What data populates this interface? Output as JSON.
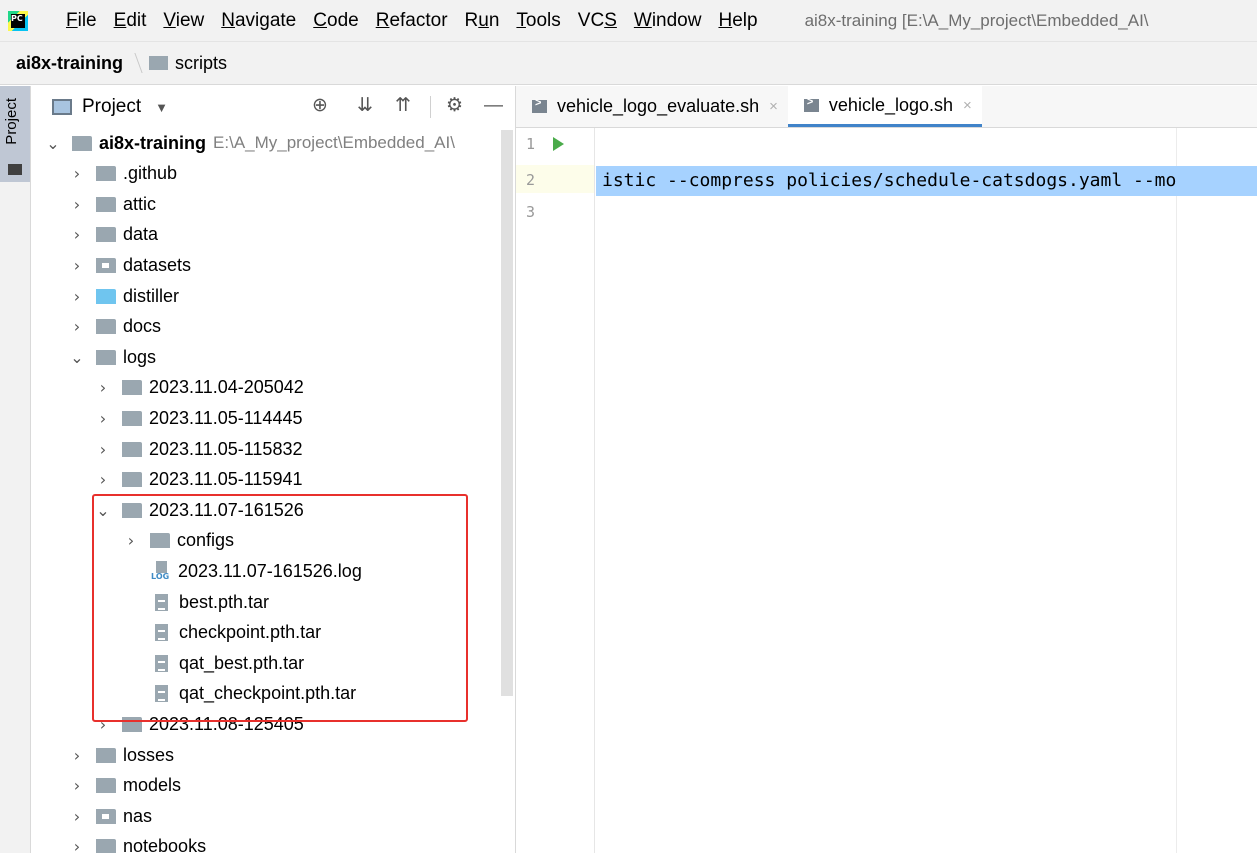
{
  "menubar": {
    "logo_text": "PC",
    "items": [
      {
        "u": "F",
        "rest": "ile"
      },
      {
        "u": "E",
        "rest": "dit"
      },
      {
        "u": "V",
        "rest": "iew"
      },
      {
        "u": "N",
        "rest": "avigate"
      },
      {
        "u": "C",
        "rest": "ode"
      },
      {
        "u": "R",
        "rest": "efactor"
      },
      {
        "pre": "R",
        "u": "u",
        "rest": "n"
      },
      {
        "u": "T",
        "rest": "ools"
      },
      {
        "pre": "VC",
        "u": "S",
        "rest": ""
      },
      {
        "u": "W",
        "rest": "indow"
      },
      {
        "u": "H",
        "rest": "elp"
      }
    ],
    "window_title": "ai8x-training [E:\\A_My_project\\Embedded_AI\\"
  },
  "breadcrumb": {
    "root": "ai8x-training",
    "folder": "scripts"
  },
  "left_stripe": {
    "label": "Project"
  },
  "project_panel": {
    "title": "Project",
    "caret": "▼",
    "buttons": {
      "locate": "⊕",
      "expand": "⇊",
      "collapse": "⇈",
      "settings": "⚙",
      "hide": "—"
    }
  },
  "tree": [
    {
      "label": "ai8x-training",
      "path": "E:\\A_My_project\\Embedded_AI\\",
      "bold": true,
      "chev": "⌄",
      "icon": "folder",
      "depth": 0
    },
    {
      "label": ".github",
      "chev": "›",
      "icon": "folder",
      "depth": 1
    },
    {
      "label": "attic",
      "chev": "›",
      "icon": "folder",
      "depth": 1
    },
    {
      "label": "data",
      "chev": "›",
      "icon": "folder",
      "depth": 1
    },
    {
      "label": "datasets",
      "chev": "›",
      "icon": "package",
      "depth": 1
    },
    {
      "label": "distiller",
      "chev": "›",
      "icon": "folder-blue",
      "depth": 1
    },
    {
      "label": "docs",
      "chev": "›",
      "icon": "folder",
      "depth": 1
    },
    {
      "label": "logs",
      "chev": "⌄",
      "icon": "folder",
      "depth": 1
    },
    {
      "label": "2023.11.04-205042",
      "chev": "›",
      "icon": "folder",
      "depth": 2
    },
    {
      "label": "2023.11.05-114445",
      "chev": "›",
      "icon": "folder",
      "depth": 2
    },
    {
      "label": "2023.11.05-115832",
      "chev": "›",
      "icon": "folder",
      "depth": 2
    },
    {
      "label": "2023.11.05-115941",
      "chev": "›",
      "icon": "folder",
      "depth": 2
    },
    {
      "label": "2023.11.07-161526",
      "chev": "⌄",
      "icon": "folder",
      "depth": 2
    },
    {
      "label": "configs",
      "chev": "›",
      "icon": "folder",
      "depth": 3
    },
    {
      "label": "2023.11.07-161526.log",
      "chev": "",
      "icon": "log",
      "depth": 3
    },
    {
      "label": "best.pth.tar",
      "chev": "",
      "icon": "file",
      "depth": 3
    },
    {
      "label": "checkpoint.pth.tar",
      "chev": "",
      "icon": "file",
      "depth": 3
    },
    {
      "label": "qat_best.pth.tar",
      "chev": "",
      "icon": "file",
      "depth": 3
    },
    {
      "label": "qat_checkpoint.pth.tar",
      "chev": "",
      "icon": "file",
      "depth": 3
    },
    {
      "label": "2023.11.08-125405",
      "chev": "›",
      "icon": "folder",
      "depth": 2
    },
    {
      "label": "losses",
      "chev": "›",
      "icon": "folder",
      "depth": 1
    },
    {
      "label": "models",
      "chev": "›",
      "icon": "folder",
      "depth": 1
    },
    {
      "label": "nas",
      "chev": "›",
      "icon": "package",
      "depth": 1
    },
    {
      "label": "notebooks",
      "chev": "›",
      "icon": "folder",
      "depth": 1
    }
  ],
  "log_icon_text": "LOG",
  "editor": {
    "tabs": [
      {
        "label": "vehicle_logo_evaluate.sh",
        "active": false,
        "close": "×"
      },
      {
        "label": "vehicle_logo.sh",
        "active": true,
        "close": "×"
      }
    ],
    "line_numbers": [
      "1",
      "2",
      "3"
    ],
    "code_line_2": "istic --compress policies/schedule-catsdogs.yaml --mo"
  },
  "colors": {
    "highlight_border": "#e8302c",
    "selection": "#a6d2ff",
    "folder": "#9aa7b0",
    "accent": "#4083c9"
  }
}
